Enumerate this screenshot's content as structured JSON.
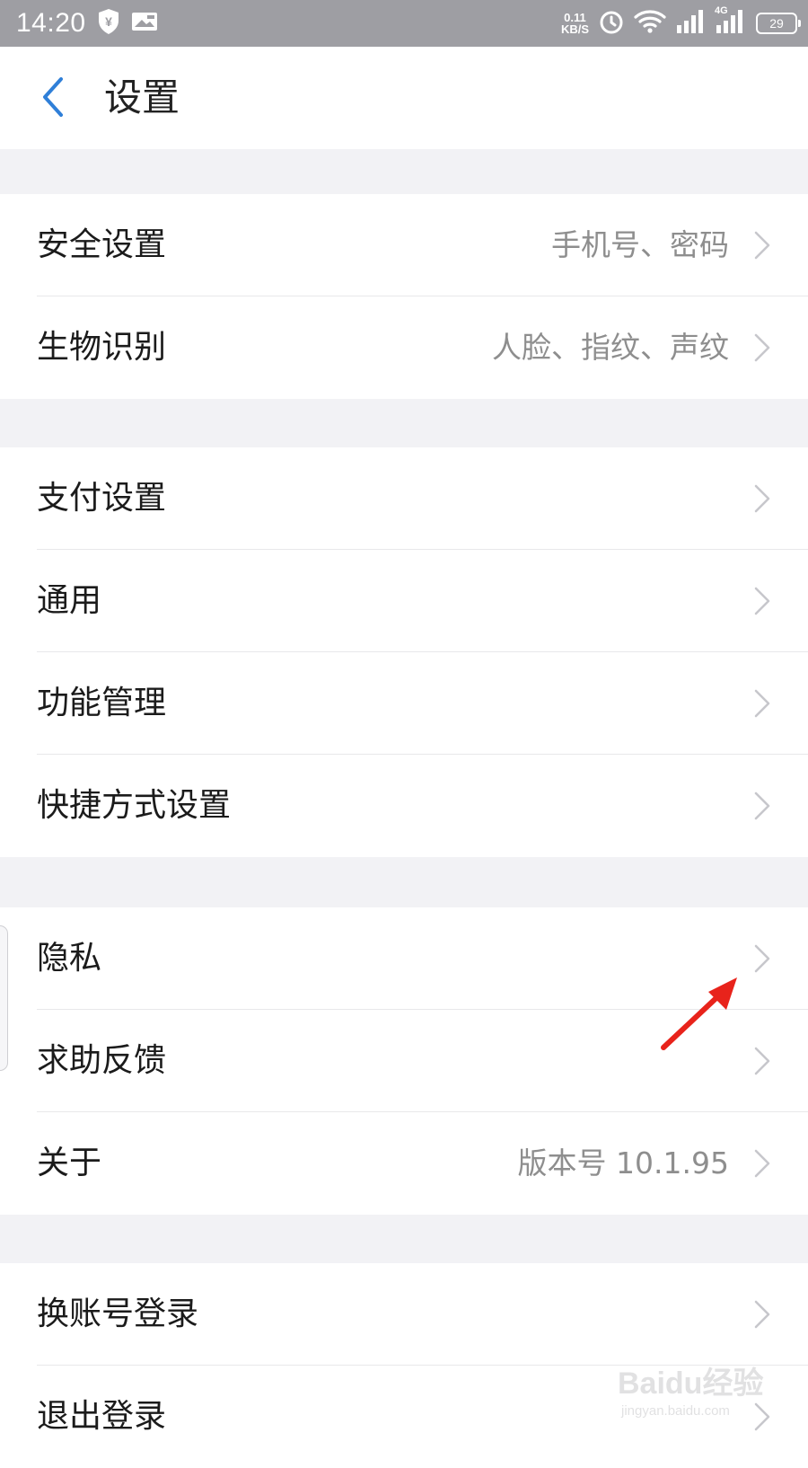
{
  "status_bar": {
    "time": "14:20",
    "net_speed_value": "0.11",
    "net_speed_unit": "KB/S",
    "network_type": "4G",
    "battery": "29",
    "left_icons": [
      "shield-yen-icon",
      "image-notification-icon"
    ],
    "right_icons": [
      "alarm-icon",
      "wifi-icon",
      "signal-icon",
      "signal-4g-icon",
      "battery-icon"
    ]
  },
  "header": {
    "title": "设置",
    "back_icon": "chevron-left-icon"
  },
  "groups": [
    {
      "items": [
        {
          "label": "安全设置",
          "value": "手机号、密码"
        },
        {
          "label": "生物识别",
          "value": "人脸、指纹、声纹"
        }
      ]
    },
    {
      "items": [
        {
          "label": "支付设置",
          "value": ""
        },
        {
          "label": "通用",
          "value": ""
        },
        {
          "label": "功能管理",
          "value": ""
        },
        {
          "label": "快捷方式设置",
          "value": ""
        }
      ]
    },
    {
      "items": [
        {
          "label": "隐私",
          "value": ""
        },
        {
          "label": "求助反馈",
          "value": ""
        },
        {
          "label": "关于",
          "value": "版本号 10.1.95"
        }
      ]
    },
    {
      "items": [
        {
          "label": "换账号登录",
          "value": ""
        },
        {
          "label": "退出登录",
          "value": ""
        }
      ]
    }
  ],
  "annotation": {
    "color": "#e8231b",
    "points_to": "隐私"
  },
  "watermark": {
    "brand": "Baidu经验",
    "url": "jingyan.baidu.com"
  },
  "colors": {
    "accent": "#2f7fd8",
    "status_bar": "#9e9ea3",
    "background": "#f2f2f5",
    "secondary_text": "#8e8e8e",
    "chevron": "#c7c7cc"
  }
}
